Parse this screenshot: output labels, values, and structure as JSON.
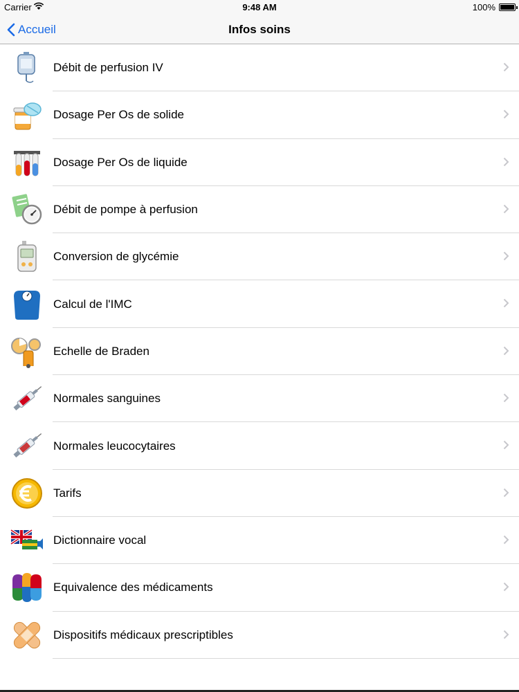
{
  "status": {
    "carrier": "Carrier",
    "time": "9:48 AM",
    "battery": "100%"
  },
  "nav": {
    "back_label": "Accueil",
    "title": "Infos soins"
  },
  "items": [
    {
      "label": "Débit de perfusion IV",
      "icon": "iv-bag-icon"
    },
    {
      "label": "Dosage Per Os de solide",
      "icon": "pill-bottle-icon"
    },
    {
      "label": "Dosage Per Os de liquide",
      "icon": "test-tubes-icon"
    },
    {
      "label": "Débit de pompe à perfusion",
      "icon": "pump-gauge-icon"
    },
    {
      "label": "Conversion de glycémie",
      "icon": "glucometer-icon"
    },
    {
      "label": "Calcul de l'IMC",
      "icon": "scale-icon"
    },
    {
      "label": "Echelle de Braden",
      "icon": "braden-scale-icon"
    },
    {
      "label": "Normales sanguines",
      "icon": "syringe-icon"
    },
    {
      "label": "Normales leucocytaires",
      "icon": "syringe-icon"
    },
    {
      "label": "Tarifs",
      "icon": "euro-coin-icon"
    },
    {
      "label": "Dictionnaire vocal",
      "icon": "flag-speaker-icon"
    },
    {
      "label": "Equivalence des médicaments",
      "icon": "colored-capsules-icon"
    },
    {
      "label": "Dispositifs médicaux prescriptibles",
      "icon": "bandage-icon"
    }
  ],
  "colors": {
    "accent": "#1a6ae6",
    "separator": "#d9d9d9",
    "chevron": "#c7c7cc"
  }
}
